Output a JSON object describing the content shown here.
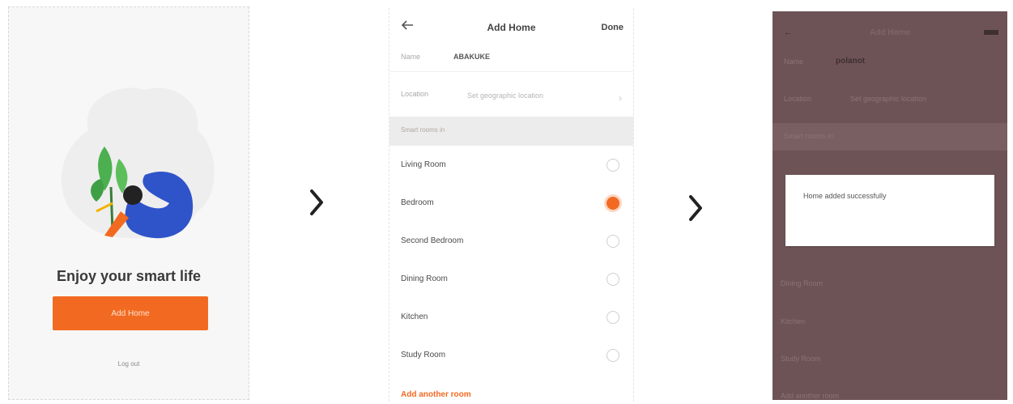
{
  "screen1": {
    "title": "Enjoy your smart life",
    "add_home_button": "Add Home",
    "logout_link": "Log out"
  },
  "screen2": {
    "title": "Add Home",
    "done": "Done",
    "name_label": "Name",
    "name_value": "ABAKUKE",
    "location_label": "Location",
    "location_placeholder": "Set geographic location",
    "section_label": "Smart rooms in",
    "rooms": [
      {
        "label": "Living Room",
        "checked": false
      },
      {
        "label": "Bedroom",
        "checked": true
      },
      {
        "label": "Second Bedroom",
        "checked": false
      },
      {
        "label": "Dining Room",
        "checked": false
      },
      {
        "label": "Kitchen",
        "checked": false
      },
      {
        "label": "Study Room",
        "checked": false
      }
    ],
    "add_room": "Add another room",
    "accent_color": "#f26a21"
  },
  "screen3": {
    "title": "Add Home",
    "name_label": "Name",
    "name_value": "polanot",
    "location_label": "Location",
    "location_placeholder": "Set geographic location",
    "section_label": "Smart rooms in",
    "dialog_message": "Home added successfully",
    "rooms": [
      "Dining Room",
      "Kitchen",
      "Study Room"
    ],
    "add_room": "Add another room"
  }
}
